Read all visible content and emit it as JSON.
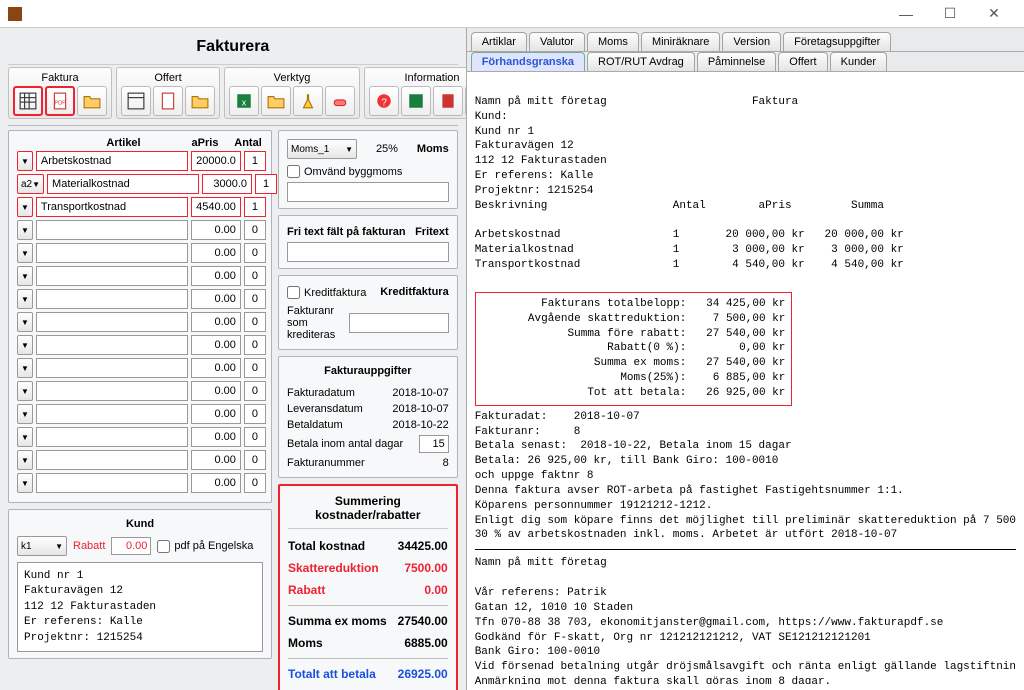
{
  "app_title": "Fakturera",
  "toolbar": {
    "groups": {
      "faktura": "Faktura",
      "offert": "Offert",
      "verktyg": "Verktyg",
      "information": "Information"
    }
  },
  "articles": {
    "header": {
      "article": "Artikel",
      "price": "aPris",
      "qty": "Antal"
    },
    "rows": [
      {
        "code": "",
        "name": "Arbetskostnad",
        "price": "20000.0",
        "qty": "1",
        "hl": true
      },
      {
        "code": "a2",
        "name": "Materialkostnad",
        "price": "3000.0",
        "qty": "1",
        "hl": true
      },
      {
        "code": "",
        "name": "Transportkostnad",
        "price": "4540.00",
        "qty": "1",
        "hl": true
      },
      {
        "code": "",
        "name": "",
        "price": "0.00",
        "qty": "0"
      },
      {
        "code": "",
        "name": "",
        "price": "0.00",
        "qty": "0"
      },
      {
        "code": "",
        "name": "",
        "price": "0.00",
        "qty": "0"
      },
      {
        "code": "",
        "name": "",
        "price": "0.00",
        "qty": "0"
      },
      {
        "code": "",
        "name": "",
        "price": "0.00",
        "qty": "0"
      },
      {
        "code": "",
        "name": "",
        "price": "0.00",
        "qty": "0"
      },
      {
        "code": "",
        "name": "",
        "price": "0.00",
        "qty": "0"
      },
      {
        "code": "",
        "name": "",
        "price": "0.00",
        "qty": "0"
      },
      {
        "code": "",
        "name": "",
        "price": "0.00",
        "qty": "0"
      },
      {
        "code": "",
        "name": "",
        "price": "0.00",
        "qty": "0"
      },
      {
        "code": "",
        "name": "",
        "price": "0.00",
        "qty": "0"
      },
      {
        "code": "",
        "name": "",
        "price": "0.00",
        "qty": "0"
      }
    ]
  },
  "moms": {
    "dropdown": "Moms_1",
    "percent": "25%",
    "section": "Moms",
    "reverse_label": "Omvänd byggmoms"
  },
  "fritext": {
    "label": "Fri text fält på fakturan",
    "section": "Fritext"
  },
  "kredit": {
    "section": "Kreditfaktura",
    "chk_label": "Kreditfaktura",
    "ref_label": "Fakturanr som krediteras"
  },
  "uppgifter": {
    "title": "Fakturauppgifter",
    "fakturadatum_l": "Fakturadatum",
    "fakturadatum_v": "2018-10-07",
    "leveransdatum_l": "Leveransdatum",
    "leveransdatum_v": "2018-10-07",
    "betaldatum_l": "Betaldatum",
    "betaldatum_v": "2018-10-22",
    "dagar_l": "Betala inom antal dagar",
    "dagar_v": "15",
    "nummer_l": "Fakturanummer",
    "nummer_v": "8"
  },
  "kund": {
    "title": "Kund",
    "dd": "k1",
    "rabatt_l": "Rabatt",
    "rabatt_v": "0.00",
    "pdf_eng": "pdf på Engelska",
    "lines": "Kund nr 1\nFakturavägen 12\n112 12 Fakturastaden\nEr referens: Kalle\nProjektnr: 1215254"
  },
  "summary": {
    "title": "Summering kostnader/rabatter",
    "total_l": "Total kostnad",
    "total_v": "34425.00",
    "skatt_l": "Skattereduktion",
    "skatt_v": "7500.00",
    "rabatt_l": "Rabatt",
    "rabatt_v": "0.00",
    "exmoms_l": "Summa ex moms",
    "exmoms_v": "27540.00",
    "moms_l": "Moms",
    "moms_v": "6885.00",
    "totalt_l": "Totalt att betala",
    "totalt_v": "26925.00"
  },
  "tabs": {
    "row1": [
      "Artiklar",
      "Valutor",
      "Moms",
      "Miniräknare",
      "Version",
      "Företagsuppgifter"
    ],
    "row2": [
      "Förhandsgranska",
      "ROT/RUT Avdrag",
      "Påminnelse",
      "Offert",
      "Kunder"
    ],
    "active": "Förhandsgranska"
  },
  "preview": {
    "head": "Namn på mitt företag                      Faktura\nKund:\nKund nr 1\nFakturavägen 12\n112 12 Fakturastaden\nEr referens: Kalle\nProjektnr: 1215254\nBeskrivning                   Antal        aPris         Summa\n\nArbetskostnad                 1       20 000,00 kr   20 000,00 kr\nMaterialkostnad               1        3 000,00 kr    3 000,00 kr\nTransportkostnad              1        4 540,00 kr    4 540,00 kr",
    "box": "        Fakturans totalbelopp:   34 425,00 kr\n       Avgående skattreduktion:    7 500,00 kr\n            Summa före rabatt:   27 540,00 kr\n                  Rabatt(0 %):        0,00 kr\n                Summa ex moms:   27 540,00 kr\n                    Moms(25%):    6 885,00 kr\n               Tot att betala:   26 925,00 kr",
    "mid": "Fakturadat:    2018-10-07\nFakturanr:     8\nBetala senast:  2018-10-22, Betala inom 15 dagar\nBetala: 26 925,00 kr, till Bank Giro: 100-0010\noch uppge faktnr 8\nDenna faktura avser ROT-arbeta på fastighet Fastigehtsnummer 1:1.\nKöparens personnummer 19121212-1212.\nEnligt dig som köpare finns det möjlighet till preliminär skattereduktion på 7 500\n30 % av arbetskostnaden inkl. moms. Arbetet är utfört 2018-10-07",
    "foot": "Namn på mitt företag\n\nVår referens: Patrik\nGatan 12, 1010 10 Staden\nTfn 070-88 38 703, ekonomitjanster@gmail.com, https://www.fakturapdf.se\nGodkänd för F-skatt, Org nr 121212121212, VAT SE121212121201\nBank Giro: 100-0010\nVid försenad betalning utgår dröjsmålsavgift och ränta enligt gällande lagstiftnin\nAnmärkning mot denna faktura skall göras inom 8 dagar."
  }
}
